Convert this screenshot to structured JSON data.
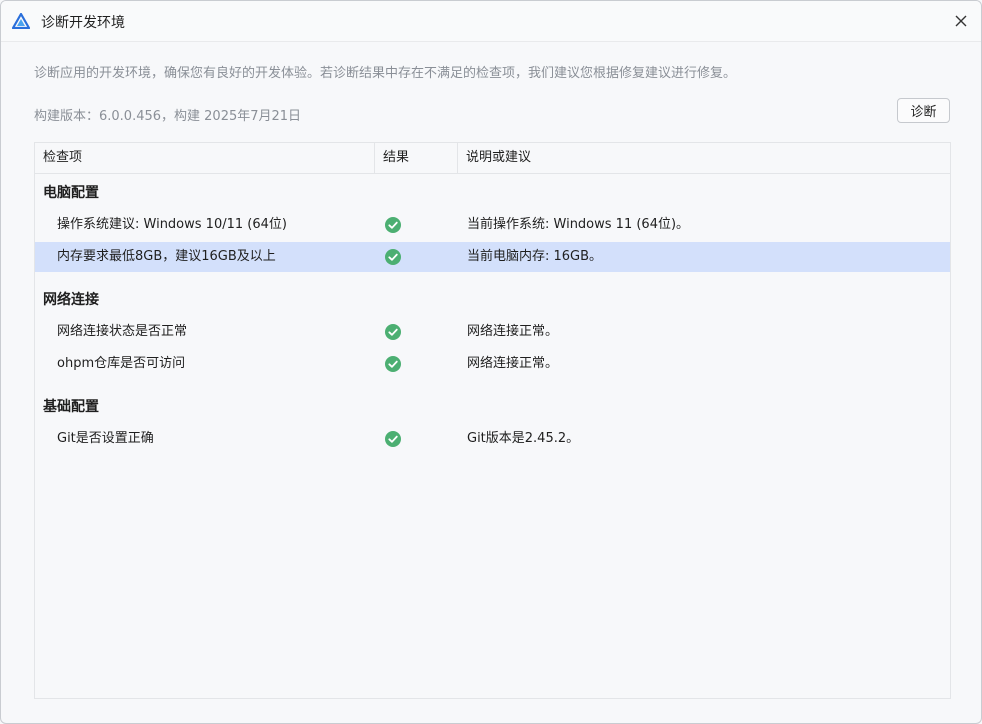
{
  "window": {
    "title": "诊断开发环境",
    "app_icon": "devstudio-logo-icon",
    "close_icon": "close-icon"
  },
  "description": "诊断应用的开发环境，确保您有良好的开发体验。若诊断结果中存在不满足的检查项，我们建议您根据修复建议进行修复。",
  "version_text": "构建版本：6.0.0.456，构建 2025年7月21日",
  "diagnose_button": "诊断",
  "colors": {
    "success": "#4caf72",
    "selected_row": "#d3e0fb"
  },
  "table": {
    "headers": [
      "检查项",
      "结果",
      "说明或建议"
    ],
    "groups": [
      {
        "name": "电脑配置",
        "rows": [
          {
            "item": "操作系统建议: Windows 10/11 (64位)",
            "result_icon": "check-circle-icon",
            "note": "当前操作系统: Windows 11 (64位)。",
            "selected": false
          },
          {
            "item": "内存要求最低8GB，建议16GB及以上",
            "result_icon": "check-circle-icon",
            "note": "当前电脑内存: 16GB。",
            "selected": true
          }
        ]
      },
      {
        "name": "网络连接",
        "rows": [
          {
            "item": "网络连接状态是否正常",
            "result_icon": "check-circle-icon",
            "note": "网络连接正常。",
            "selected": false
          },
          {
            "item": "ohpm仓库是否可访问",
            "result_icon": "check-circle-icon",
            "note": "网络连接正常。",
            "selected": false
          }
        ]
      },
      {
        "name": "基础配置",
        "rows": [
          {
            "item": "Git是否设置正确",
            "result_icon": "check-circle-icon",
            "note": "Git版本是2.45.2。",
            "selected": false
          }
        ]
      }
    ]
  }
}
